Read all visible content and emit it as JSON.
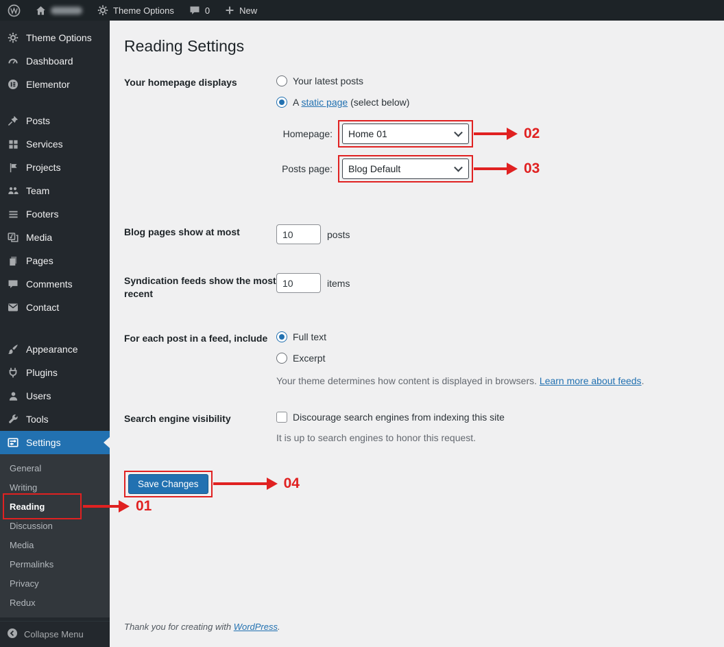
{
  "colors": {
    "accent": "#2271b1",
    "annotation_red": "#e02121",
    "topbar_bg": "#1d2327",
    "sidebar_bg": "#23282d",
    "content_bg": "#f0f0f1"
  },
  "topbar": {
    "theme_options": "Theme Options",
    "comments_count": "0",
    "new_label": "New"
  },
  "sidebar": {
    "items": [
      {
        "label": "Theme Options",
        "icon": "gear-icon"
      },
      {
        "label": "Dashboard",
        "icon": "dashboard-gauge-icon"
      },
      {
        "label": "Elementor",
        "icon": "elementor-icon"
      },
      {
        "label": "Posts",
        "icon": "pushpin-icon"
      },
      {
        "label": "Services",
        "icon": "grid-icon"
      },
      {
        "label": "Projects",
        "icon": "flag-icon"
      },
      {
        "label": "Team",
        "icon": "people-icon"
      },
      {
        "label": "Footers",
        "icon": "list-icon"
      },
      {
        "label": "Media",
        "icon": "media-icon"
      },
      {
        "label": "Pages",
        "icon": "pages-icon"
      },
      {
        "label": "Comments",
        "icon": "comment-icon"
      },
      {
        "label": "Contact",
        "icon": "mail-icon"
      },
      {
        "label": "Appearance",
        "icon": "brush-icon"
      },
      {
        "label": "Plugins",
        "icon": "plug-icon"
      },
      {
        "label": "Users",
        "icon": "user-icon"
      },
      {
        "label": "Tools",
        "icon": "wrench-icon"
      },
      {
        "label": "Settings",
        "icon": "settings-icon",
        "active": true
      }
    ],
    "settings_submenu": [
      {
        "label": "General"
      },
      {
        "label": "Writing"
      },
      {
        "label": "Reading",
        "current": true
      },
      {
        "label": "Discussion"
      },
      {
        "label": "Media"
      },
      {
        "label": "Permalinks"
      },
      {
        "label": "Privacy"
      },
      {
        "label": "Redux"
      }
    ],
    "collapse_label": "Collapse Menu"
  },
  "page": {
    "title": "Reading Settings",
    "homepage_displays": {
      "label": "Your homepage displays",
      "option_latest": "Your latest posts",
      "option_static_prefix": "A ",
      "option_static_link": "static page",
      "option_static_suffix": " (select below)",
      "selected": "static"
    },
    "homepage_row": {
      "label": "Homepage:",
      "value": "Home 01"
    },
    "posts_page_row": {
      "label": "Posts page:",
      "value": "Blog Default"
    },
    "blog_pages": {
      "label": "Blog pages show at most",
      "value": "10",
      "unit": "posts"
    },
    "syndication": {
      "label": "Syndication feeds show the most recent",
      "value": "10",
      "unit": "items"
    },
    "feed_include": {
      "label": "For each post in a feed, include",
      "option_full": "Full text",
      "option_excerpt": "Excerpt",
      "selected": "full",
      "note_text": "Your theme determines how content is displayed in browsers. ",
      "note_link": "Learn more about feeds",
      "note_period": "."
    },
    "search_visibility": {
      "label": "Search engine visibility",
      "checkbox_label": "Discourage search engines from indexing this site",
      "checked": false,
      "note": "It is up to search engines to honor this request."
    },
    "save_button": "Save Changes",
    "footer_text": "Thank you for creating with ",
    "footer_link": "WordPress",
    "footer_period": "."
  },
  "annotations": {
    "reading": "01",
    "homepage": "02",
    "posts_page": "03",
    "save": "04"
  }
}
